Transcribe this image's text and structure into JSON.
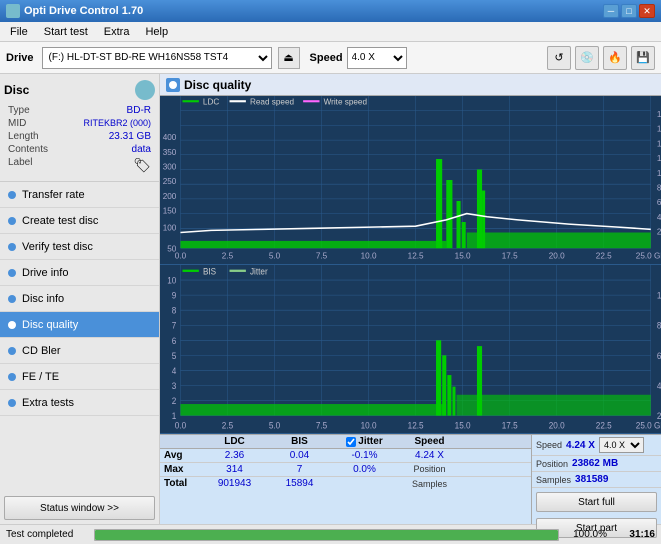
{
  "titleBar": {
    "title": "Opti Drive Control 1.70",
    "buttons": [
      "minimize",
      "maximize",
      "close"
    ]
  },
  "menuBar": {
    "items": [
      "File",
      "Start test",
      "Extra",
      "Help"
    ]
  },
  "toolbar": {
    "driveLabel": "Drive",
    "driveValue": "(F:)  HL-DT-ST BD-RE  WH16NS58 TST4",
    "speedLabel": "Speed",
    "speedValue": "4.0 X"
  },
  "leftPanel": {
    "discSection": {
      "title": "Disc",
      "fields": [
        {
          "label": "Type",
          "value": "BD-R"
        },
        {
          "label": "MID",
          "value": "RITEKBR2 (000)"
        },
        {
          "label": "Length",
          "value": "23.31 GB"
        },
        {
          "label": "Contents",
          "value": "data"
        },
        {
          "label": "Label",
          "value": ""
        }
      ]
    },
    "navItems": [
      {
        "label": "Transfer rate",
        "active": false,
        "color": "#4a90d9"
      },
      {
        "label": "Create test disc",
        "active": false,
        "color": "#4a90d9"
      },
      {
        "label": "Verify test disc",
        "active": false,
        "color": "#4a90d9"
      },
      {
        "label": "Drive info",
        "active": false,
        "color": "#4a90d9"
      },
      {
        "label": "Disc info",
        "active": false,
        "color": "#4a90d9"
      },
      {
        "label": "Disc quality",
        "active": true,
        "color": "#4a90d9"
      },
      {
        "label": "CD Bler",
        "active": false,
        "color": "#4a90d9"
      },
      {
        "label": "FE / TE",
        "active": false,
        "color": "#4a90d9"
      },
      {
        "label": "Extra tests",
        "active": false,
        "color": "#4a90d9"
      }
    ],
    "statusBtn": "Status window >>"
  },
  "rightPanel": {
    "header": "Disc quality",
    "legend1": {
      "items": [
        "LDC",
        "Read speed",
        "Write speed"
      ]
    },
    "legend2": {
      "items": [
        "BIS",
        "Jitter"
      ]
    },
    "stats": {
      "headers": [
        "LDC",
        "BIS",
        "",
        "Jitter",
        "Speed",
        ""
      ],
      "rows": [
        {
          "label": "Avg",
          "ldc": "2.36",
          "bis": "0.04",
          "jitter": "-0.1%",
          "speed": "4.24 X"
        },
        {
          "label": "Max",
          "ldc": "314",
          "bis": "7",
          "jitter": "0.0%",
          "position": "23862 MB"
        },
        {
          "label": "Total",
          "ldc": "901943",
          "bis": "15894",
          "jitter": "",
          "samples": "381589"
        }
      ],
      "speedTarget": "4.0 X",
      "jitterChecked": true
    }
  },
  "bottomBar": {
    "label": "Test completed",
    "progress": 100,
    "time": "31:16"
  },
  "actions": {
    "startFull": "Start full",
    "startPart": "Start part"
  }
}
